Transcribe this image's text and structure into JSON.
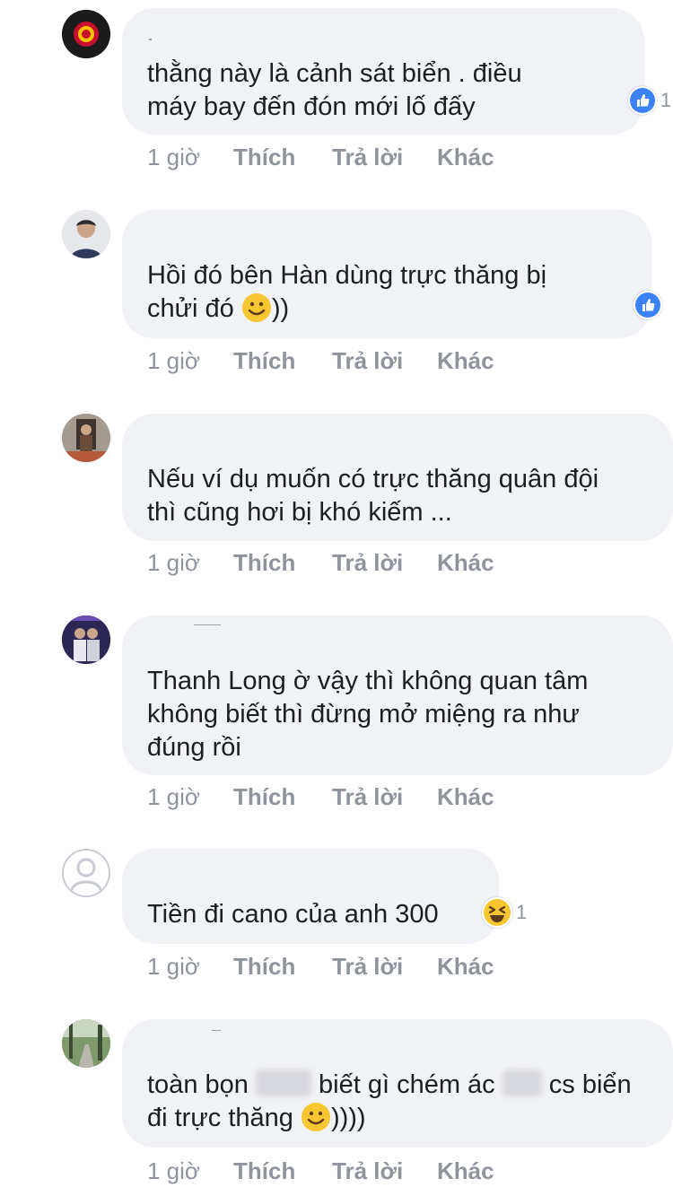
{
  "comments": [
    {
      "text_lines": [
        "thằng này là cảnh sát biển . điều",
        "máy bay đến đón mới lố đấy"
      ],
      "reaction": {
        "icon": "like-icon",
        "count": "1"
      },
      "actions": {
        "time": "1 giờ",
        "like": "Thích",
        "reply": "Trả lời",
        "more": "Khác"
      }
    },
    {
      "text_lines": [
        "Hồi đó bên Hàn dùng trực thăng bị",
        "chửi đó",
        "))"
      ],
      "reaction": {
        "icon": "like-icon",
        "count": ""
      },
      "actions": {
        "time": "1 giờ",
        "like": "Thích",
        "reply": "Trả lời",
        "more": "Khác"
      }
    },
    {
      "text_lines": [
        "Nếu ví dụ muốn có trực thăng quân đội",
        "thì cũng hơi bị khó kiếm ..."
      ],
      "actions": {
        "time": "1 giờ",
        "like": "Thích",
        "reply": "Trả lời",
        "more": "Khác"
      }
    },
    {
      "text_lines": [
        "Thanh Long ờ vậy thì không quan tâm",
        "không biết thì đừng mở miệng ra như",
        "đúng rồi"
      ],
      "actions": {
        "time": "1 giờ",
        "like": "Thích",
        "reply": "Trả lời",
        "more": "Khác"
      }
    },
    {
      "text_lines": [
        "Tiền đi cano của anh 300"
      ],
      "reaction": {
        "icon": "haha-icon",
        "count": "1"
      },
      "actions": {
        "time": "1 giờ",
        "like": "Thích",
        "reply": "Trả lời",
        "more": "Khác"
      }
    },
    {
      "text_lines": [
        "toàn bọn",
        "biết gì chém ác",
        "cs biển",
        "đi trực thăng",
        "))))"
      ],
      "actions": {
        "time": "1 giờ",
        "like": "Thích",
        "reply": "Trả lời",
        "more": "Khác"
      }
    }
  ],
  "colors": {
    "bubble": "#f1f2f6",
    "text": "#1c1e21",
    "meta": "#8f949c",
    "like_blue": "#3b82f6",
    "emoji_yellow": "#f7c631"
  }
}
